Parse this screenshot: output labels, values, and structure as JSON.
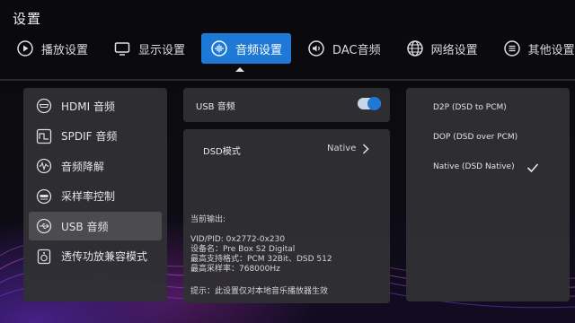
{
  "header": {
    "title": "设置"
  },
  "tabs": [
    {
      "label": "播放设置",
      "icon": "play-icon",
      "active": false
    },
    {
      "label": "显示设置",
      "icon": "monitor-icon",
      "active": false
    },
    {
      "label": "音频设置",
      "icon": "audio-wave-icon",
      "active": true
    },
    {
      "label": "DAC音频",
      "icon": "speaker-icon",
      "active": false
    },
    {
      "label": "网络设置",
      "icon": "globe-icon",
      "active": false
    },
    {
      "label": "其他设置",
      "icon": "menu-icon",
      "active": false
    }
  ],
  "sidebar": {
    "items": [
      {
        "label": "HDMI 音频",
        "icon": "hdmi-icon",
        "active": false
      },
      {
        "label": "SPDIF 音频",
        "icon": "spdif-icon",
        "active": false
      },
      {
        "label": "音频降解",
        "icon": "waveform-icon",
        "active": false
      },
      {
        "label": "采样率控制",
        "icon": "samplerate-192-icon",
        "active": false
      },
      {
        "label": "USB 音频",
        "icon": "usb-icon",
        "active": true
      },
      {
        "label": "透传功放兼容模式",
        "icon": "amplifier-icon",
        "active": false
      }
    ]
  },
  "usb_audio": {
    "label": "USB 音频",
    "enabled": true
  },
  "dsd": {
    "mode_label": "DSD模式",
    "mode_value": "Native",
    "current_output_label": "当前输出:",
    "vid_pid": "VID/PID: 0x2772-0x230",
    "device_name": "设备名：Pre Box S2 Digital",
    "formats": "最高支持格式：PCM 32Bit、DSD 512",
    "max_rate": "最高采样率：768000Hz",
    "tip": "提示：此设置仅对本地音乐播放器生效"
  },
  "dsd_options": {
    "items": [
      "D2P (DSD to PCM)",
      "DOP (DSD over PCM)",
      "Native (DSD Native)"
    ],
    "selected_index": 2
  },
  "colors": {
    "accent": "#1e78d6",
    "panel": "#303034"
  }
}
